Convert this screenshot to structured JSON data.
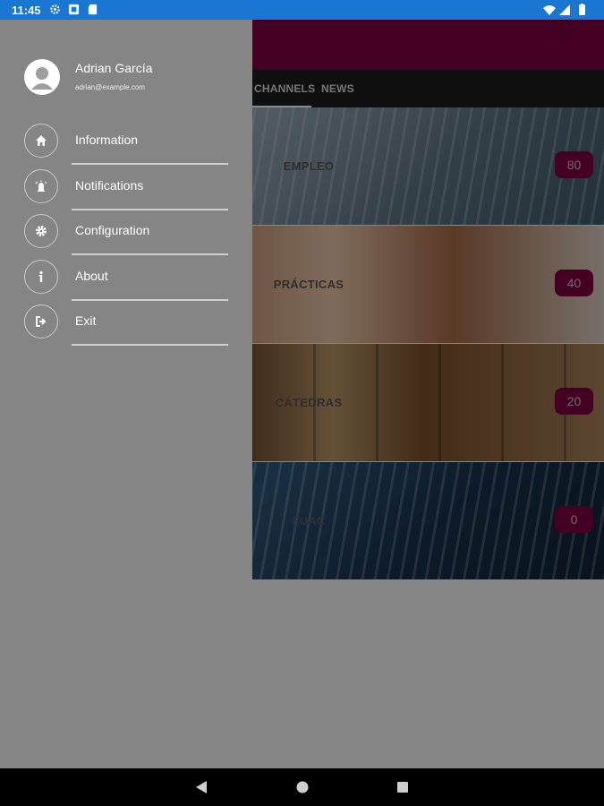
{
  "status_bar": {
    "time": "11:45"
  },
  "tabs": [
    {
      "label": "CHANNELS"
    },
    {
      "label": "NEWS"
    }
  ],
  "channels": [
    {
      "name": "EMPLEO",
      "count": "80"
    },
    {
      "name": "PRÁCTICAS",
      "count": "40"
    },
    {
      "name": "CÁTEDRAS",
      "count": "20"
    },
    {
      "name": "FUAC",
      "count": "0"
    }
  ],
  "drawer": {
    "user": {
      "name": "Adrian García",
      "email": "adrian@example.com"
    },
    "menu": [
      {
        "label": "Information",
        "icon": "home-icon"
      },
      {
        "label": "Notifications",
        "icon": "alarm-icon"
      },
      {
        "label": "Configuration",
        "icon": "gear-icon"
      },
      {
        "label": "About",
        "icon": "info-icon"
      },
      {
        "label": "Exit",
        "icon": "exit-icon"
      }
    ]
  },
  "colors": {
    "status_bar": "#1976d2",
    "app_bar": "#7a0040",
    "tab_bar": "#1c1c1c",
    "drawer": "#858585",
    "badge": "#7a0040"
  }
}
